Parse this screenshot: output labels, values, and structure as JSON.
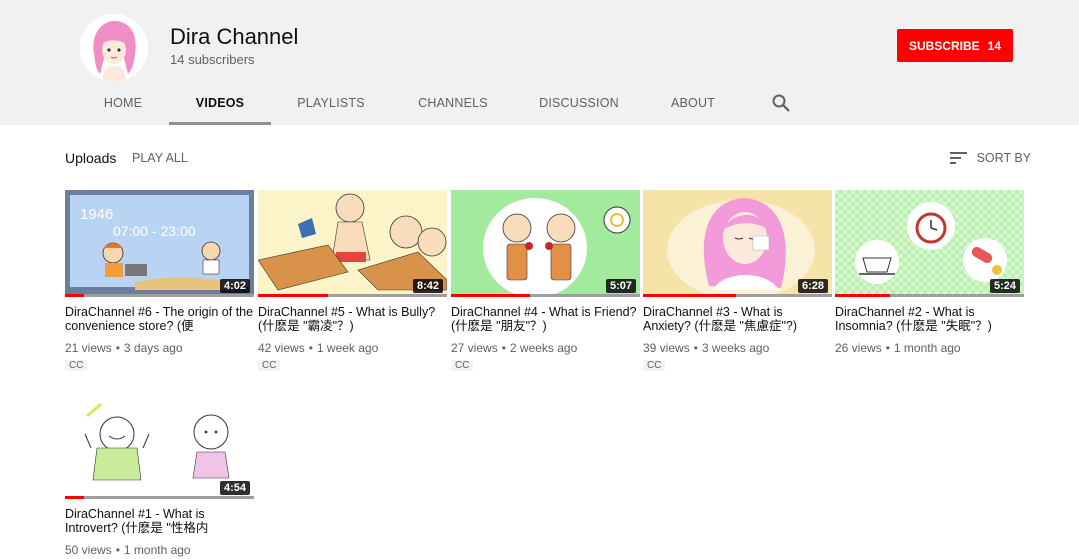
{
  "channel": {
    "name": "Dira Channel",
    "subscribers": "14 subscribers",
    "subscribe_label": "SUBSCRIBE",
    "subscribe_count": "14",
    "colors": {
      "brand_red": "#ff0000",
      "header_bg": "#f1f1f1"
    }
  },
  "tabs": [
    {
      "label": "HOME"
    },
    {
      "label": "VIDEOS"
    },
    {
      "label": "PLAYLISTS"
    },
    {
      "label": "CHANNELS"
    },
    {
      "label": "DISCUSSION"
    },
    {
      "label": "ABOUT"
    }
  ],
  "active_tab": "VIDEOS",
  "search_icon": "search-icon",
  "section": {
    "title": "Uploads",
    "play_all": "PLAY ALL",
    "sort_by": "SORT BY",
    "sort_icon": "sort-icon"
  },
  "videos": [
    {
      "title": "DiraChannel #6 - The origin of the convenience store? (便",
      "duration": "4:02",
      "views": "21 views",
      "age": "3 days ago",
      "cc": "CC",
      "watched": 0.1,
      "thumb_text": [
        "1946",
        "07:00 - 23:00"
      ]
    },
    {
      "title": "DiraChannel #5 - What is Bully? (什麽是 \"霸凌\"？)",
      "duration": "8:42",
      "views": "42 views",
      "age": "1 week ago",
      "cc": "CC",
      "watched": 0.37
    },
    {
      "title": "DiraChannel #4 - What is Friend? (什麽是 \"朋友\"？)",
      "duration": "5:07",
      "views": "27 views",
      "age": "2 weeks ago",
      "cc": "CC",
      "watched": 0.42
    },
    {
      "title": "DiraChannel #3 - What is Anxiety? (什麽是 \"焦慮症\"?)",
      "duration": "6:28",
      "views": "39 views",
      "age": "3 weeks ago",
      "cc": "CC",
      "watched": 0.49
    },
    {
      "title": "DiraChannel #2 - What is Insomnia? (什麽是 \"失眠\"？)",
      "duration": "5:24",
      "views": "26 views",
      "age": "1 month ago",
      "cc": "",
      "watched": 0.29
    },
    {
      "title": "DiraChannel #1 - What is Introvert? (什麽是 \"性格内",
      "duration": "4:54",
      "views": "50 views",
      "age": "1 month ago",
      "cc": "",
      "watched": 0.1
    }
  ]
}
